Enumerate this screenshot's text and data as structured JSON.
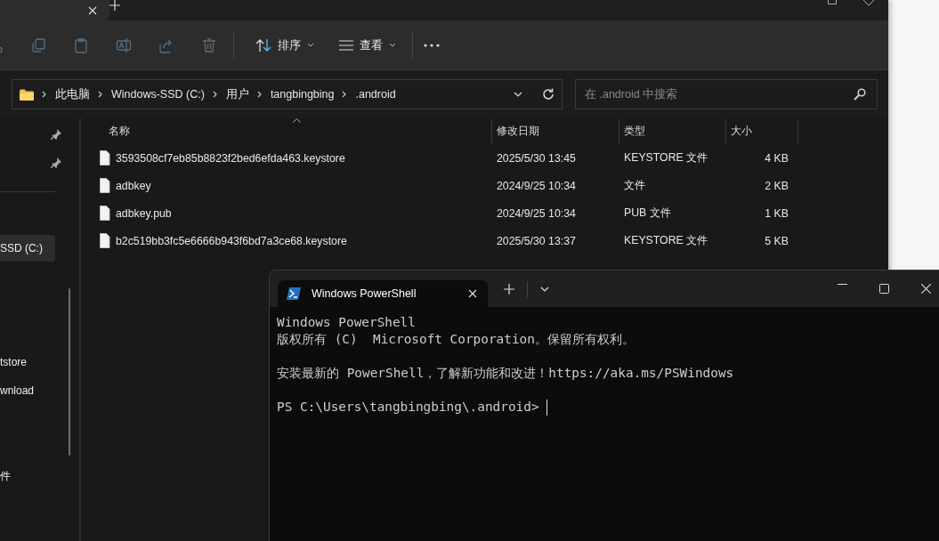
{
  "explorer": {
    "tab": {
      "selected": true
    },
    "toolbar": {
      "actions": [
        {
          "kind": "cut",
          "disabled": true
        },
        {
          "kind": "copy",
          "disabled": true
        },
        {
          "kind": "paste",
          "disabled": true
        },
        {
          "kind": "rename",
          "disabled": true
        },
        {
          "kind": "share",
          "disabled": true
        },
        {
          "kind": "delete",
          "disabled": true
        }
      ],
      "sort": "排序",
      "view": "查看"
    },
    "breadcrumb": [
      "此电脑",
      "Windows-SSD (C:)",
      "用户",
      "tangbingbing",
      ".android"
    ],
    "search": {
      "placeholder": "在 .android 中搜索"
    },
    "sidebar": {
      "items": [
        {
          "kind": "pinned"
        },
        {
          "kind": "pinned"
        },
        {
          "kind": "divider"
        },
        {
          "kind": "hidden"
        },
        {
          "kind": "item",
          "label": "SSD (C:)",
          "selected": true
        },
        {
          "kind": "hidden"
        },
        {
          "kind": "hidden"
        },
        {
          "kind": "hidden"
        },
        {
          "kind": "item",
          "label": "tstore",
          "selected": false
        },
        {
          "kind": "item",
          "label": "wnload",
          "selected": false
        },
        {
          "kind": "hidden"
        },
        {
          "kind": "hidden"
        },
        {
          "kind": "item",
          "label": "件",
          "selected": false
        }
      ]
    },
    "table": {
      "columns": [
        "名称",
        "修改日期",
        "类型",
        "大小"
      ],
      "rows": [
        {
          "name": "3593508cf7eb85b8823f2bed6efda463.keystore",
          "date": "2025/5/30 13:45",
          "type": "KEYSTORE 文件",
          "size": "4 KB"
        },
        {
          "name": "adbkey",
          "date": "2024/9/25 10:34",
          "type": "文件",
          "size": "2 KB"
        },
        {
          "name": "adbkey.pub",
          "date": "2024/9/25 10:34",
          "type": "PUB 文件",
          "size": "1 KB"
        },
        {
          "name": "b2c519bb3fc5e6666b943f6bd7a3ce68.keystore",
          "date": "2025/5/30 13:37",
          "type": "KEYSTORE 文件",
          "size": "5 KB"
        }
      ]
    }
  },
  "terminal": {
    "tab": {
      "title": "Windows PowerShell",
      "selected": true
    },
    "blocks": [
      [
        "Windows PowerShell",
        "版权所有 (C)  Microsoft Corporation。保留所有权利。"
      ],
      [
        "安装最新的 PowerShell，了解新功能和改进！https://aka.ms/PSWindows"
      ]
    ],
    "prompt": "PS C:\\Users\\tangbingbing\\.android>"
  }
}
